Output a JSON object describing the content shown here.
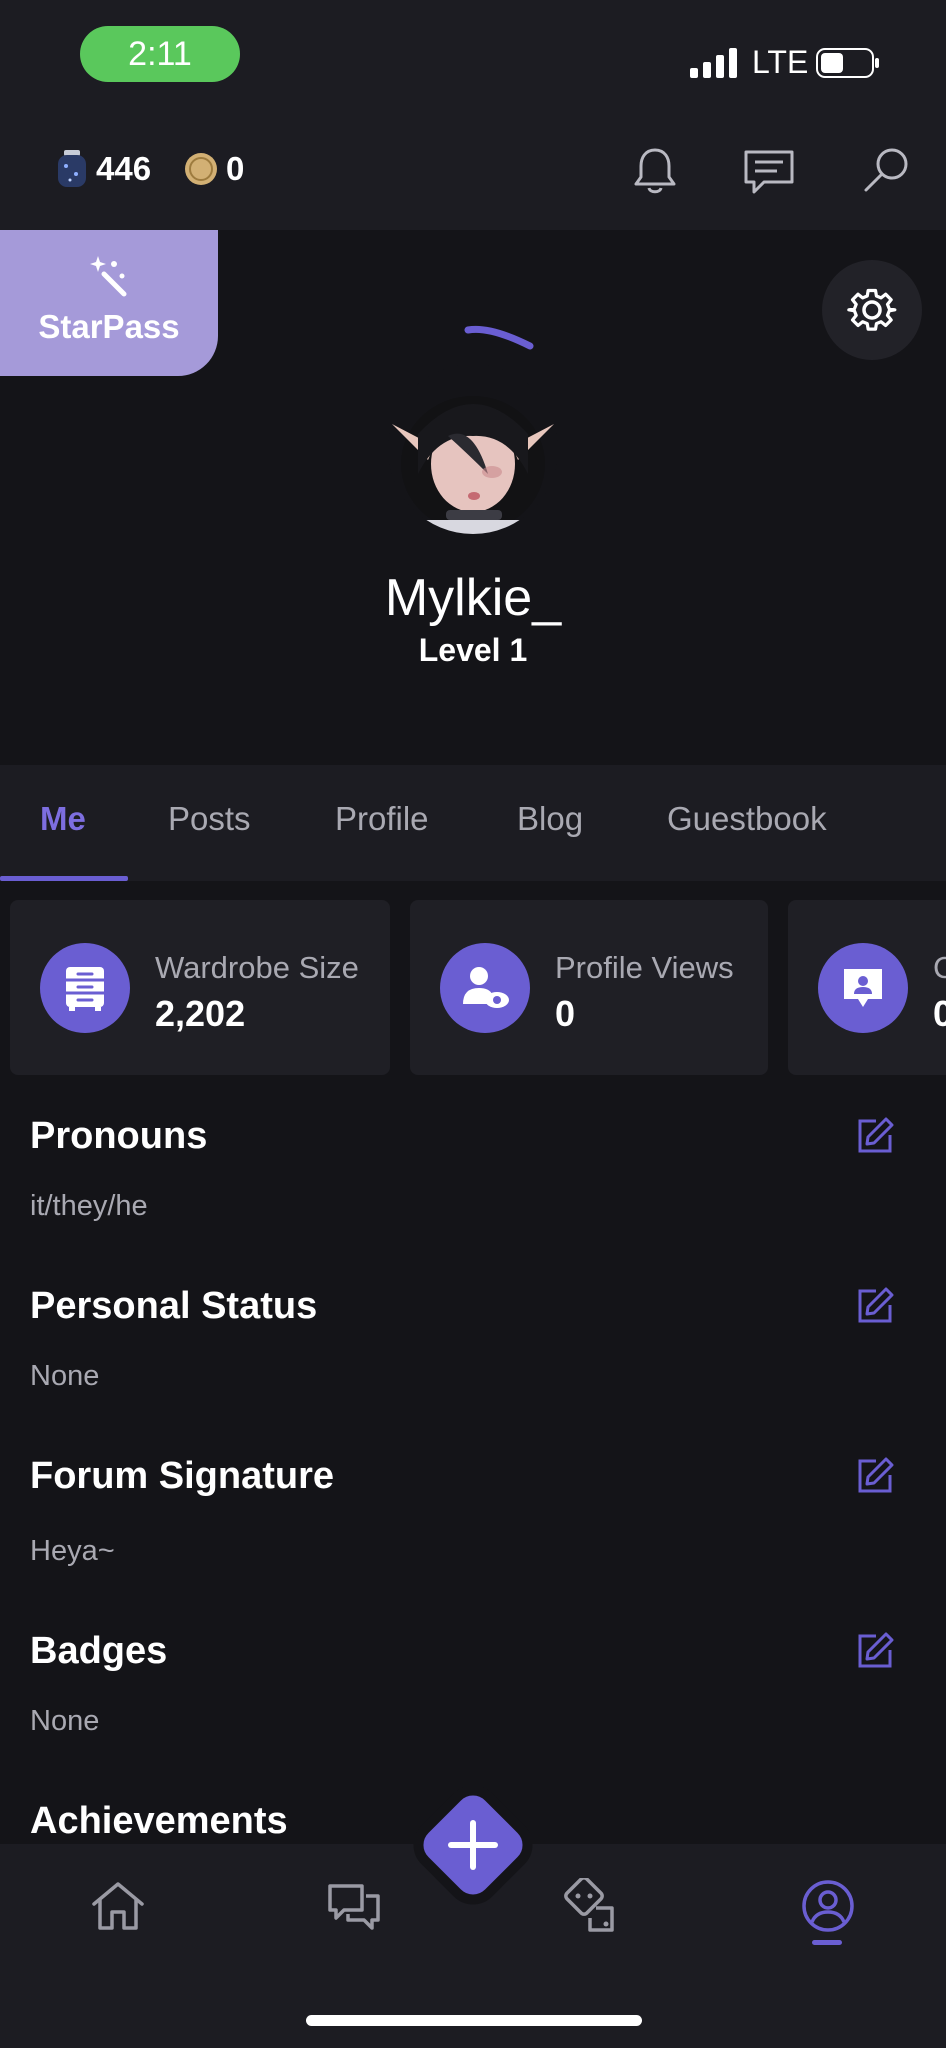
{
  "status_bar": {
    "time": "2:11",
    "carrier": "LTE"
  },
  "header": {
    "currency_1": "446",
    "currency_2": "0"
  },
  "starpass": {
    "label": "StarPass"
  },
  "profile": {
    "username": "Mylkie_",
    "level": "Level 1"
  },
  "tabs": [
    {
      "label": "Me"
    },
    {
      "label": "Posts"
    },
    {
      "label": "Profile"
    },
    {
      "label": "Blog"
    },
    {
      "label": "Guestbook"
    }
  ],
  "stats": [
    {
      "label": "Wardrobe Size",
      "value": "2,202"
    },
    {
      "label": "Profile Views",
      "value": "0"
    },
    {
      "label": "C",
      "value": "0"
    }
  ],
  "sections": [
    {
      "title": "Pronouns",
      "value": "it/they/he"
    },
    {
      "title": "Personal Status",
      "value": "None"
    },
    {
      "title": "Forum Signature",
      "value": "Heya~"
    },
    {
      "title": "Badges",
      "value": "None"
    },
    {
      "title": "Achievements"
    }
  ],
  "colors": {
    "accent": "#6a5ed2",
    "starpass": "#a59ad9",
    "background": "#141418",
    "panel": "#1f1f25"
  }
}
